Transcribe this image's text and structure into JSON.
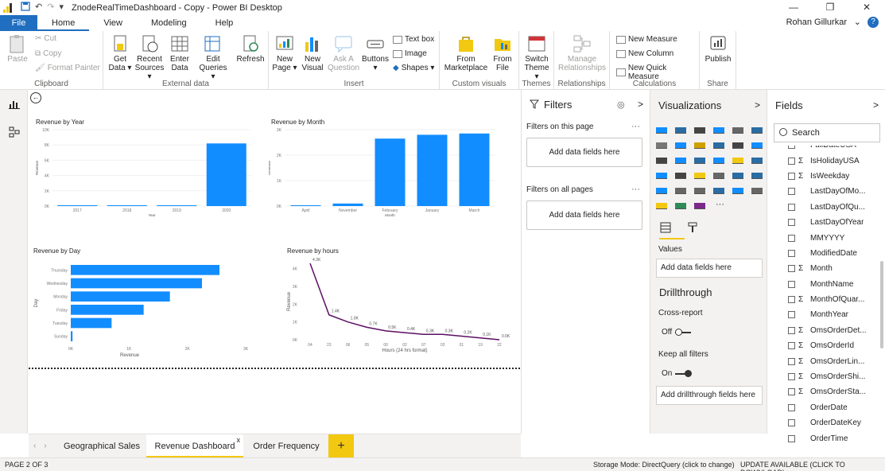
{
  "window": {
    "title": "ZnodeRealTimeDashboard - Copy - Power BI Desktop",
    "min": "—",
    "restore": "❐",
    "close": "✕"
  },
  "tabs": {
    "file": "File",
    "items": [
      "Home",
      "View",
      "Modeling",
      "Help"
    ],
    "user": "Rohan Gillurkar",
    "help_icon": "?"
  },
  "ribbon": {
    "clipboard": {
      "label": "Clipboard",
      "paste": "Paste",
      "cut": "Cut",
      "copy": "Copy",
      "format_painter": "Format Painter"
    },
    "external": {
      "label": "External data",
      "get_data": "Get",
      "get_data2": "Data ▾",
      "recent": "Recent",
      "recent2": "Sources ▾",
      "enter": "Enter",
      "enter2": "Data",
      "edit": "Edit",
      "edit2": "Queries ▾",
      "refresh": "Refresh"
    },
    "insert": {
      "label": "Insert",
      "new_page": "New",
      "new_page2": "Page ▾",
      "new_visual": "New",
      "new_visual2": "Visual",
      "ask": "Ask A",
      "ask2": "Question",
      "buttons": "Buttons",
      "buttons2": "▾",
      "text_box": "Text box",
      "image": "Image",
      "shapes": "Shapes ▾"
    },
    "custom": {
      "label": "Custom visuals",
      "marketplace": "From",
      "marketplace2": "Marketplace",
      "file": "From",
      "file2": "File"
    },
    "themes": {
      "label": "Themes",
      "switch": "Switch",
      "switch2": "Theme ▾"
    },
    "relationships": {
      "label": "Relationships",
      "manage": "Manage",
      "manage2": "Relationships"
    },
    "calculations": {
      "label": "Calculations",
      "new_measure": "New Measure",
      "new_column": "New Column",
      "quick_measure": "New Quick Measure"
    },
    "share": {
      "label": "Share",
      "publish": "Publish"
    }
  },
  "charts": {
    "year": {
      "title": "Revenue by Year",
      "ylabel": "Revenue",
      "xlabel": "Year"
    },
    "month": {
      "title": "Revenue by Month",
      "ylabel": "Revenue",
      "xlabel": "Month"
    },
    "day": {
      "title": "Revenue by Day",
      "ylabel": "Day",
      "xlabel": "Revenue"
    },
    "hours": {
      "title": "Revenue by hours",
      "ylabel": "Revenue",
      "xlabel": "Hours (24 hrs format)"
    }
  },
  "chart_data": [
    {
      "type": "bar",
      "title": "Revenue by Year",
      "xlabel": "Year",
      "ylabel": "Revenue",
      "categories": [
        "2017",
        "2018",
        "2019",
        "2020"
      ],
      "values": [
        100,
        0,
        0,
        8200
      ],
      "ylim": [
        0,
        10000
      ],
      "yticks": [
        "0K",
        "2K",
        "4K",
        "6K",
        "8K",
        "10K"
      ],
      "color": "#118dff"
    },
    {
      "type": "bar",
      "title": "Revenue by Month",
      "xlabel": "Month",
      "ylabel": "Revenue",
      "categories": [
        "April",
        "November",
        "February",
        "January",
        "March"
      ],
      "values": [
        20,
        100,
        2650,
        2800,
        2850
      ],
      "ylim": [
        0,
        3000
      ],
      "yticks": [
        "0K",
        "1K",
        "2K",
        "3K"
      ],
      "color": "#118dff"
    },
    {
      "type": "bar",
      "orientation": "horizontal",
      "title": "Revenue by Day",
      "xlabel": "Revenue",
      "ylabel": "Day",
      "categories": [
        "Thursday",
        "Wednesday",
        "Monday",
        "Friday",
        "Tuesday",
        "Sunday"
      ],
      "values": [
        2550,
        2250,
        1700,
        1250,
        700,
        30
      ],
      "xlim": [
        0,
        3000
      ],
      "xticks": [
        "0K",
        "1K",
        "2K",
        "3K"
      ],
      "color": "#118dff"
    },
    {
      "type": "line",
      "title": "Revenue by hours",
      "xlabel": "Hours (24 hrs format)",
      "ylabel": "Revenue",
      "categories": [
        "04",
        "23",
        "06",
        "05",
        "00",
        "02",
        "07",
        "03",
        "01",
        "19",
        "22"
      ],
      "values": [
        4300,
        1400,
        1000,
        700,
        500,
        400,
        300,
        300,
        200,
        100,
        0
      ],
      "data_labels": [
        "4.3K",
        "1.4K",
        "1.0K",
        "0.7K",
        "0.5K",
        "0.4K",
        "0.3K",
        "0.3K",
        "0.2K",
        "0.1K",
        "0.0K"
      ],
      "ylim": [
        0,
        4300
      ],
      "yticks": [
        "0K",
        "1K",
        "2K",
        "3K",
        "4K"
      ],
      "color": "#5b0f63"
    }
  ],
  "filters": {
    "title": "Filters",
    "on_page": "Filters on this page",
    "all_pages": "Filters on all pages",
    "add": "Add data fields here",
    "more": "···",
    "chev": ">"
  },
  "visualizations": {
    "title": "Visualizations",
    "chev": ">",
    "values": "Values",
    "add": "Add data fields here",
    "drillthrough": "Drillthrough",
    "cross_report": "Cross-report",
    "off": "Off",
    "keep_filters": "Keep all filters",
    "on": "On",
    "add_drill": "Add drillthrough fields here",
    "more_icon": "···"
  },
  "fields": {
    "title": "Fields",
    "chev": ">",
    "search_placeholder": "Search",
    "items": [
      {
        "name": "FullDateUSA",
        "sigma": false
      },
      {
        "name": "IsHolidayUSA",
        "sigma": true
      },
      {
        "name": "IsWeekday",
        "sigma": true
      },
      {
        "name": "LastDayOfMo...",
        "sigma": false
      },
      {
        "name": "LastDayOfQu...",
        "sigma": false
      },
      {
        "name": "LastDayOfYear",
        "sigma": false
      },
      {
        "name": "MMYYYY",
        "sigma": false
      },
      {
        "name": "ModifiedDate",
        "sigma": false
      },
      {
        "name": "Month",
        "sigma": true
      },
      {
        "name": "MonthName",
        "sigma": false
      },
      {
        "name": "MonthOfQuar...",
        "sigma": true
      },
      {
        "name": "MonthYear",
        "sigma": false
      },
      {
        "name": "OmsOrderDet...",
        "sigma": true
      },
      {
        "name": "OmsOrderId",
        "sigma": true
      },
      {
        "name": "OmsOrderLin...",
        "sigma": true
      },
      {
        "name": "OmsOrderShi...",
        "sigma": true
      },
      {
        "name": "OmsOrderSta...",
        "sigma": true
      },
      {
        "name": "OrderDate",
        "sigma": false
      },
      {
        "name": "OrderDateKey",
        "sigma": false
      },
      {
        "name": "OrderTime",
        "sigma": false
      }
    ]
  },
  "pages": {
    "tabs": [
      "Geographical Sales",
      "Revenue Dashboard",
      "Order Frequency"
    ],
    "active": 1,
    "close": "x",
    "add": "+"
  },
  "status": {
    "page": "PAGE 2 OF 3",
    "storage": "Storage Mode: DirectQuery (click to change)",
    "update": "UPDATE AVAILABLE (CLICK TO DOWNLOAD)"
  },
  "colors": {
    "accent": "#1f6ebf",
    "bar": "#118dff",
    "line": "#5b0f63",
    "yellow": "#f2c811"
  }
}
